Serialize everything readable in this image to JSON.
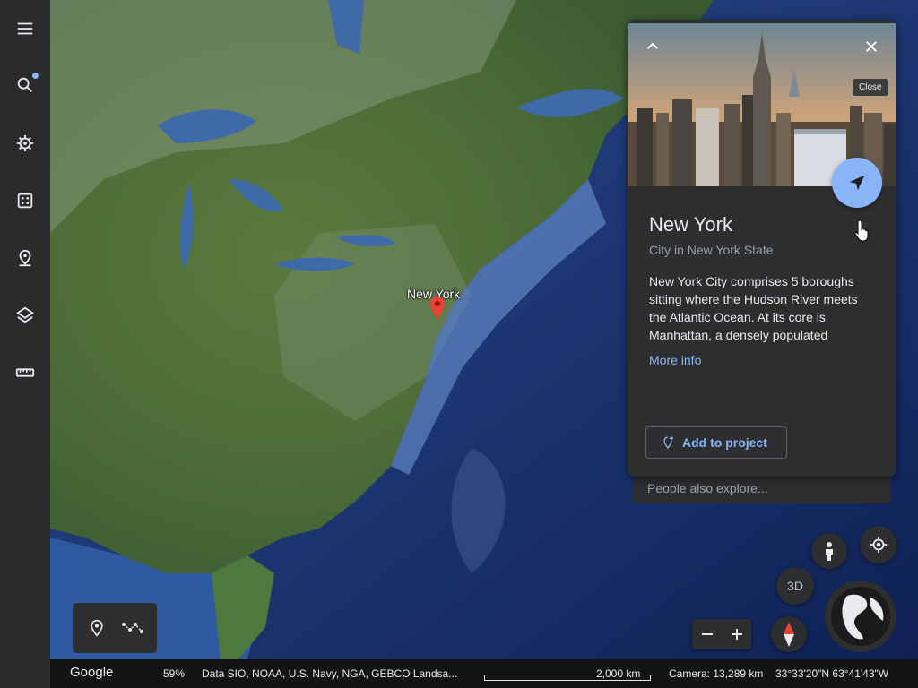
{
  "sidebar": {
    "items": [
      {
        "name": "menu-icon"
      },
      {
        "name": "search-icon",
        "has_badge": true
      },
      {
        "name": "voyager-icon"
      },
      {
        "name": "feeling-lucky-icon"
      },
      {
        "name": "projects-icon"
      },
      {
        "name": "map-style-icon"
      },
      {
        "name": "measure-icon"
      }
    ]
  },
  "map": {
    "pin_label": "New York"
  },
  "card": {
    "tooltip_close": "Close",
    "title": "New York",
    "subtitle": "City in New York State",
    "description": "New York City comprises 5 boroughs sitting where the Hudson River meets the Atlantic Ocean. At its core is Manhattan, a densely populated",
    "more_info": "More info",
    "add_to_project": "Add to project",
    "people_also_explore": "People also explore..."
  },
  "controls": {
    "btn_3d": "3D",
    "zoom_out": "−",
    "zoom_in": "+"
  },
  "status": {
    "logo": "Google",
    "load_progress": "59%",
    "attribution": "Data SIO, NOAA, U.S. Navy, NGA, GEBCO  Landsa...",
    "scale": "2,000 km",
    "camera": "Camera: 13,289 km",
    "coordinates": "33°33'20\"N 63°41'43\"W"
  },
  "colors": {
    "accent": "#8ab4f8",
    "panel": "#2d2e30",
    "sidebar": "#2a2b2d",
    "pin": "#ea4335"
  }
}
